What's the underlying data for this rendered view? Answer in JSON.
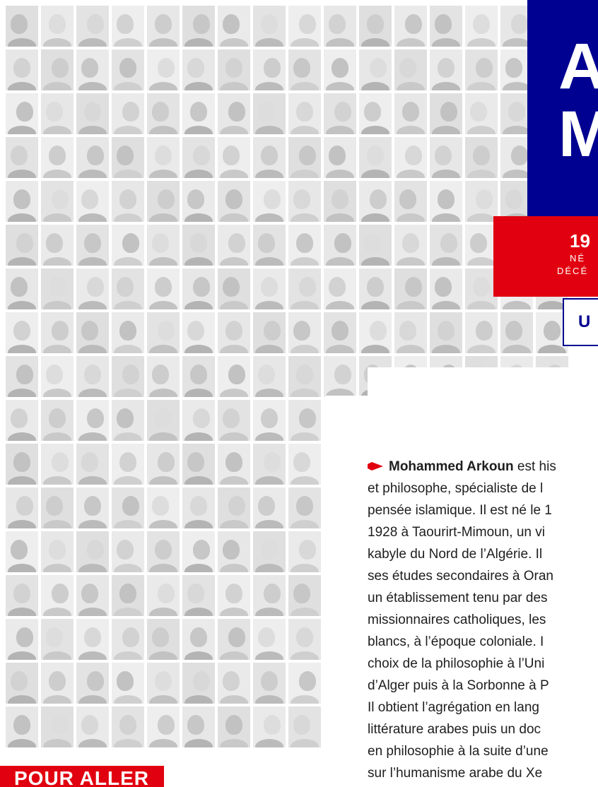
{
  "header": {
    "name_line1": "A",
    "name_line2": "M",
    "years": "19",
    "born_label": "NÉ",
    "died_label": "DÉCÉ",
    "tag": "U"
  },
  "bio": {
    "lead_name": "Mohammed Arkoun",
    "lines": [
      " est his",
      "et philosophe, spécialiste de l",
      "pensée islamique. Il est né le 1",
      "1928 à Taourirt-Mimoun, un vi",
      "kabyle du Nord de l’Algérie. Il",
      "ses études secondaires à Oran",
      "un établissement tenu par des",
      "missionnaires catholiques, les",
      "blancs, à l’époque coloniale. I",
      "choix de la philosophie à l’Uni",
      "d’Alger puis à la Sorbonne à P",
      "Il obtient l’agrégation en lang",
      "littérature arabes puis un doc",
      "en philosophie à la suite d’une",
      "sur l’humanisme arabe du Xe"
    ]
  },
  "footer": {
    "pour_aller": "POUR ALLER"
  },
  "colors": {
    "blue": "#000091",
    "red": "#e1000f"
  },
  "icons": {
    "bullet": "arrow-icon"
  }
}
